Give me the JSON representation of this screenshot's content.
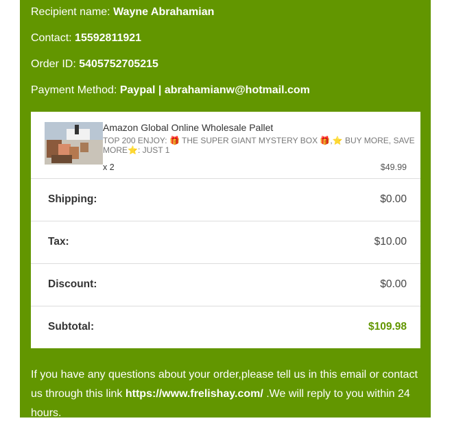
{
  "recipient": {
    "label": "Recipient name:",
    "value": "Wayne Abrahamian"
  },
  "contact": {
    "label": "Contact:",
    "value": "15592811921"
  },
  "order_id": {
    "label": "Order ID:",
    "value": "5405752705215"
  },
  "payment": {
    "label": "Payment Method:",
    "value": "Paypal | abrahamianw@hotmail.com"
  },
  "item": {
    "name": "Amazon Global Online Wholesale Pallet",
    "variant_part1": "TOP 200 ENJOY:",
    "emoji_gift": "🎁",
    "variant_part2": "THE SUPER GIANT MYSTERY BOX",
    "emoji_star": "⭐",
    "variant_part3": "BUY MORE, SAVE MORE",
    "variant_part4": ": JUST 1",
    "qty": "x 2",
    "price": "$49.99"
  },
  "summary": {
    "shipping_label": "Shipping:",
    "shipping_value": "$0.00",
    "tax_label": "Tax:",
    "tax_value": "$10.00",
    "discount_label": "Discount:",
    "discount_value": "$0.00",
    "subtotal_label": "Subtotal:",
    "subtotal_value": "$109.98"
  },
  "footer": {
    "text_before": "If you have any questions about your order,please tell us in this email or contact us through this link ",
    "link": "https://www.frelishay.com/",
    "text_after": " .We will reply to you within 24 hours."
  },
  "colors": {
    "panel_green": "#629600",
    "subtotal_green": "#629600"
  }
}
